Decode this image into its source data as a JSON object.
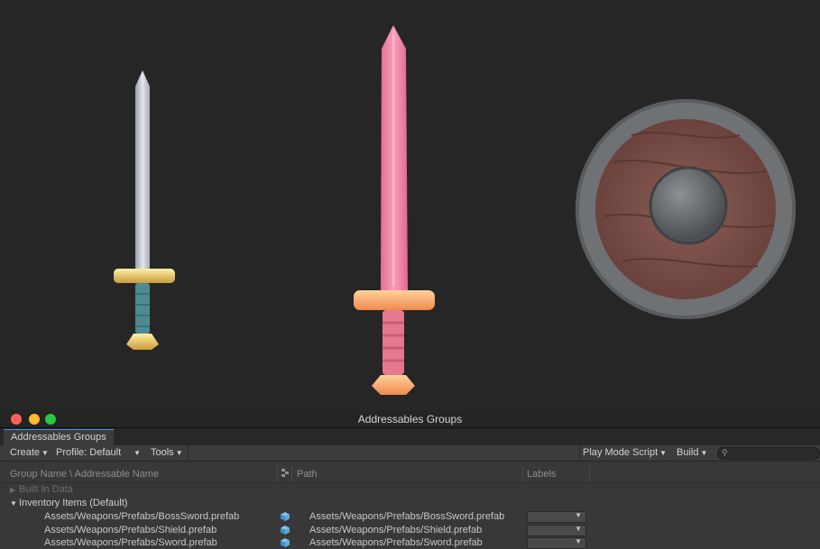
{
  "window": {
    "title": "Addressables Groups"
  },
  "tab": {
    "label": "Addressables Groups"
  },
  "toolbar": {
    "create": "Create",
    "profile": "Profile: Default",
    "tools": "Tools",
    "play_mode_script": "Play Mode Script",
    "build": "Build"
  },
  "table": {
    "headers": {
      "name": "Group Name \\ Addressable Name",
      "path": "Path",
      "labels": "Labels"
    },
    "groups": [
      {
        "name": "Built In Data",
        "expanded": false
      },
      {
        "name": "Inventory Items (Default)",
        "expanded": true
      }
    ],
    "entries": [
      {
        "name": "Assets/Weapons/Prefabs/BossSword.prefab",
        "path": "Assets/Weapons/Prefabs/BossSword.prefab",
        "icon": "prefab-cube-icon"
      },
      {
        "name": "Assets/Weapons/Prefabs/Shield.prefab",
        "path": "Assets/Weapons/Prefabs/Shield.prefab",
        "icon": "prefab-cube-icon"
      },
      {
        "name": "Assets/Weapons/Prefabs/Sword.prefab",
        "path": "Assets/Weapons/Prefabs/Sword.prefab",
        "icon": "prefab-cube-icon"
      }
    ]
  },
  "colors": {
    "scene_background": "#262626",
    "sword_blade": "#c9cdd6",
    "boss_sword_blade": "#f07fa0",
    "shield_wood": "#7a4f48",
    "shield_rim": "#6f7274"
  }
}
